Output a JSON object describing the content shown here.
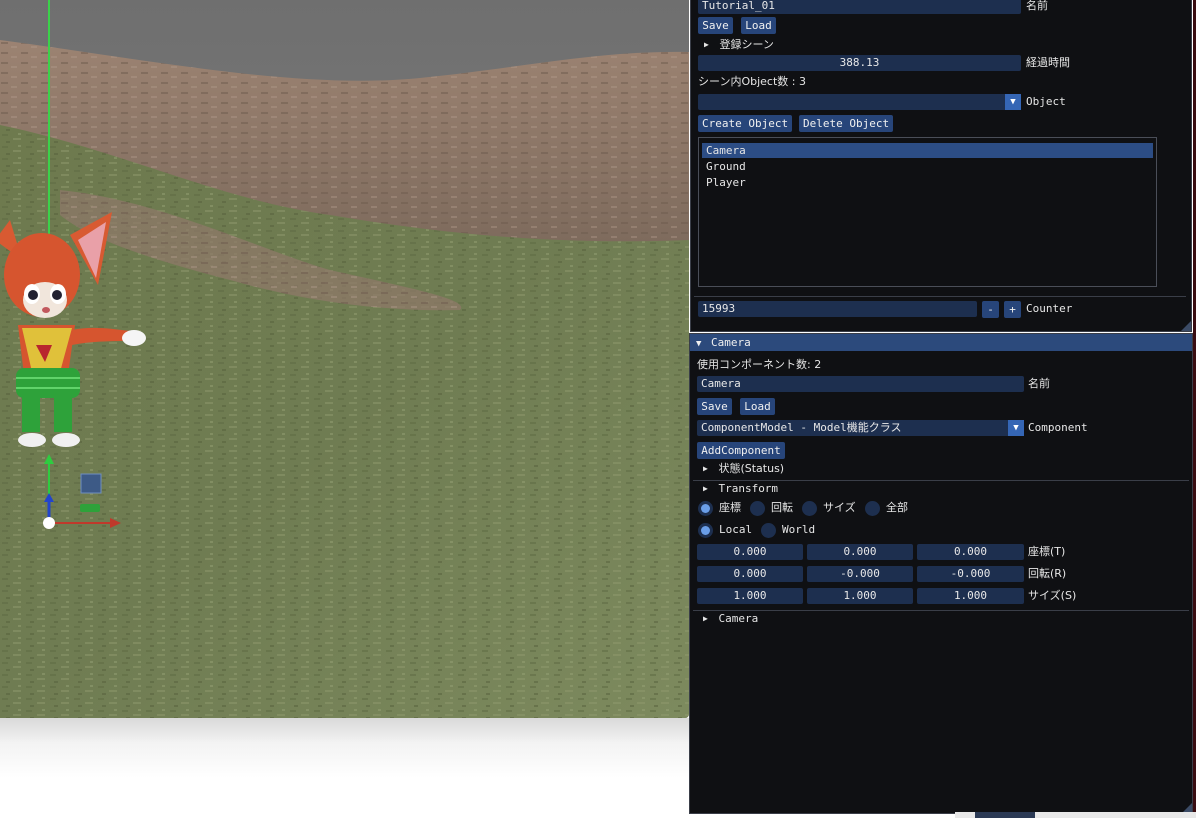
{
  "scene_panel": {
    "scene_name": {
      "value": "Tutorial_01",
      "label": "名前"
    },
    "save_label": "Save",
    "load_label": "Load",
    "registered_scenes_label": "登録シーン",
    "elapsed": {
      "value": "388.13",
      "label": "経過時間"
    },
    "object_count_label": "シーン内Object数 : 3",
    "object_combo": {
      "value": "",
      "label": "Object"
    },
    "create_object_label": "Create Object",
    "delete_object_label": "Delete Object",
    "objects": [
      "Camera",
      "Ground",
      "Player"
    ],
    "selected_object_index": 0,
    "counter": {
      "value": "15993",
      "minus": "-",
      "plus": "+",
      "label": "Counter"
    }
  },
  "inspector": {
    "title": "Camera",
    "component_count_label": "使用コンポーネント数: 2",
    "name": {
      "value": "Camera",
      "label": "名前"
    },
    "save_label": "Save",
    "load_label": "Load",
    "component_combo": {
      "value": "ComponentModel - Model機能クラス",
      "label": "Component"
    },
    "add_component_label": "AddComponent",
    "status_header": "状態(Status)",
    "transform_header": "Transform",
    "gizmo_modes": [
      {
        "label": "座標",
        "selected": true
      },
      {
        "label": "回転",
        "selected": false
      },
      {
        "label": "サイズ",
        "selected": false
      },
      {
        "label": "全部",
        "selected": false
      }
    ],
    "spaces": [
      {
        "label": "Local",
        "selected": true
      },
      {
        "label": "World",
        "selected": false
      }
    ],
    "position": {
      "x": "0.000",
      "y": "0.000",
      "z": "0.000",
      "label": "座標(T)"
    },
    "rotation": {
      "x": "0.000",
      "y": "-0.000",
      "z": "-0.000",
      "label": "回転(R)"
    },
    "scale": {
      "x": "1.000",
      "y": "1.000",
      "z": "1.000",
      "label": "サイズ(S)"
    },
    "camera_header": "Camera"
  },
  "icons": {
    "collapsed_arrow": "▶",
    "expanded_arrow": "▼",
    "combo_arrow": "▼"
  },
  "colors": {
    "panel_bg": "#0f1013",
    "field_bg": "#1d2f4f",
    "button_bg": "#27457a",
    "selection": "#2c4d85",
    "gizmo_x": "#c0392b",
    "gizmo_y": "#2ecc40",
    "gizmo_z": "#2244cc"
  }
}
